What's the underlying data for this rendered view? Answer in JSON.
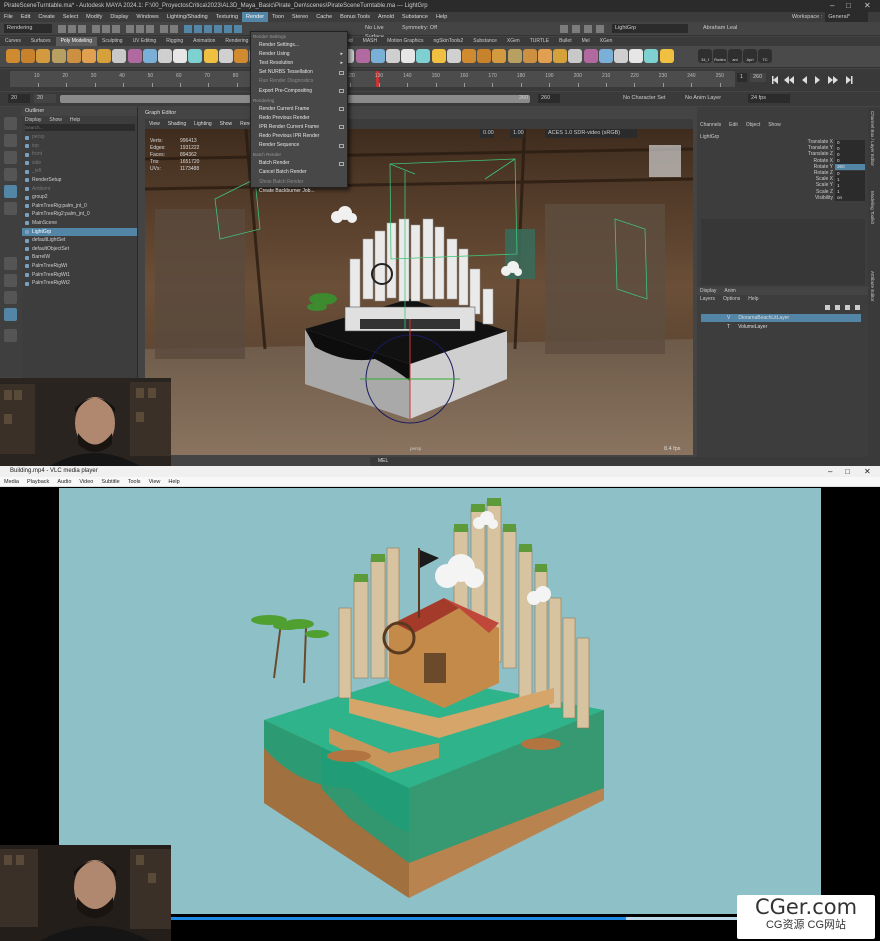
{
  "maya": {
    "title": "PirateSceneTurntable.ma* - Autodesk MAYA 2024.1: F:\\00_ProyectosCritica\\2023\\AL3D_Maya_Basic\\Pirate_Den\\scenes\\PirateSceneTurntable.ma  ---  LightGrp",
    "menus": [
      "File",
      "Edit",
      "Create",
      "Select",
      "Modify",
      "Display",
      "Windows",
      "Lighting/Shading",
      "Texturing",
      "Render",
      "Toon",
      "Stereo",
      "Cache",
      "Bonus Tools",
      "Arnold",
      "Substance",
      "Help"
    ],
    "workspace_label": "Workspace :",
    "workspace_value": "General*",
    "mode": "Rendering",
    "symmetry": "Symmetry: Off",
    "live_surface": "No Live Surface",
    "search_object": "LightGrp",
    "user": "Abraham Leal",
    "shelf_tabs": [
      "Curves",
      "Surfaces",
      "Poly Modeling",
      "Sculpting",
      "UV Editing",
      "Rigging",
      "Animation",
      "Rendering",
      "FX",
      "FX Caching",
      "Custom",
      "Arnold",
      "MASH",
      "Motion Graphics",
      "ngSkinTools2",
      "Substance",
      "XGen",
      "TURTLE",
      "Bullet",
      "Mel",
      "XGen"
    ],
    "shelf_labels": [
      "34_f",
      "Rodeo",
      "ani",
      "Apri",
      "TC"
    ],
    "timeline_ticks": [
      "10",
      "20",
      "30",
      "40",
      "50",
      "60",
      "70",
      "80",
      "90",
      "100",
      "110",
      "120",
      "130",
      "140",
      "150",
      "160",
      "170",
      "180",
      "190",
      "200",
      "210",
      "220",
      "230",
      "240",
      "250"
    ],
    "current_frame": "1",
    "end_frame": "260",
    "range_start": "20",
    "range_inner_start": "20",
    "range_end": "260",
    "range_end2": "260",
    "character_set": "No Character Set",
    "anim_layer": "No Anim Layer",
    "fps_setting": "24 fps",
    "outliner": {
      "title": "Outliner",
      "menu": [
        "Display",
        "Show",
        "Help"
      ],
      "search_placeholder": "Search...",
      "items": [
        {
          "label": "persp",
          "dim": true
        },
        {
          "label": "top",
          "dim": true
        },
        {
          "label": "front",
          "dim": true
        },
        {
          "label": "side",
          "dim": true
        },
        {
          "label": "_left",
          "dim": true
        },
        {
          "label": "RenderSetup",
          "dim": false
        },
        {
          "label": "Ambient",
          "dim": true
        },
        {
          "label": "group2",
          "dim": false
        },
        {
          "label": "PalmTreeRig:palm_jnt_0",
          "dim": false
        },
        {
          "label": "PalmTreeRig2:palm_jnt_0",
          "dim": false
        },
        {
          "label": "MainScene",
          "dim": false
        },
        {
          "label": "LightGrp",
          "dim": false,
          "selected": true
        },
        {
          "label": "defaultLightSet",
          "dim": false
        },
        {
          "label": "defaultObjectSet",
          "dim": false
        },
        {
          "label": "BarrelW",
          "dim": false
        },
        {
          "label": "PalmTreeRigWt",
          "dim": false
        },
        {
          "label": "PalmTreeRigWt1",
          "dim": false
        },
        {
          "label": "PalmTreeRigWt2",
          "dim": false
        }
      ]
    },
    "graph_editor": "Graph Editor",
    "viewport_menu": [
      "View",
      "Shading",
      "Lighting",
      "Show",
      "Renderer",
      "Panels"
    ],
    "hud": [
      {
        "label": "Verts:",
        "value": "996413"
      },
      {
        "label": "Edges:",
        "value": "1931222"
      },
      {
        "label": "Faces:",
        "value": "894362"
      },
      {
        "label": "Tris:",
        "value": "1651720"
      },
      {
        "label": "UVs:",
        "value": "1173488"
      }
    ],
    "color_space": "ACES 1.0 SDR-video (sRGB)",
    "exposure": "0.00",
    "gamma": "1.00",
    "viewport_fps": "8.4 fps",
    "camera": "persp",
    "render_menu": {
      "items": [
        {
          "label": "Render Settings",
          "type": "section"
        },
        {
          "label": "Render Settings...",
          "type": "item"
        },
        {
          "label": "Render Using",
          "type": "sub"
        },
        {
          "label": "Test Resolution",
          "type": "sub"
        },
        {
          "label": "Set NURBS Tessellation",
          "type": "box"
        },
        {
          "label": "Run Render Diagnostics",
          "type": "dim"
        },
        {
          "label": "Export Pre-Compositing",
          "type": "box"
        },
        {
          "label": "Rendering",
          "type": "section"
        },
        {
          "label": "Render Current Frame",
          "type": "box"
        },
        {
          "label": "Redo Previous Render",
          "type": "item"
        },
        {
          "label": "IPR Render Current Frame",
          "type": "box"
        },
        {
          "label": "Redo Previous IPR Render",
          "type": "item"
        },
        {
          "label": "Render Sequence",
          "type": "box"
        },
        {
          "label": "Batch Render",
          "type": "section"
        },
        {
          "label": "Batch Render",
          "type": "box"
        },
        {
          "label": "Cancel Batch Render",
          "type": "item"
        },
        {
          "label": "Show Batch Render",
          "type": "dim"
        },
        {
          "label": "Create Backburner Job...",
          "type": "item"
        }
      ]
    },
    "channel_box": {
      "menu": [
        "Channels",
        "Edit",
        "Object",
        "Show"
      ],
      "object": "LightGrp",
      "channels": [
        {
          "label": "Translate X",
          "value": "0"
        },
        {
          "label": "Translate Y",
          "value": "0"
        },
        {
          "label": "Translate Z",
          "value": "0"
        },
        {
          "label": "Rotate X",
          "value": "0"
        },
        {
          "label": "Rotate Y",
          "value": "360",
          "hl": true
        },
        {
          "label": "Rotate Z",
          "value": "0"
        },
        {
          "label": "Scale X",
          "value": "1"
        },
        {
          "label": "Scale Y",
          "value": "1"
        },
        {
          "label": "Scale Z",
          "value": "1"
        },
        {
          "label": "Visibility",
          "value": "on"
        }
      ]
    },
    "layer_editor": {
      "tabs": [
        "Display",
        "Anim"
      ],
      "menu": [
        "Layers",
        "Options",
        "Help"
      ],
      "layers": [
        {
          "flag": "V",
          "label": "DioramaBeachLitLayer",
          "selected": true
        },
        {
          "flag": "T",
          "label": "VolumeLayer",
          "selected": false
        }
      ]
    },
    "side_tabs": [
      "Channel Box / Layer Editor",
      "Modeling Toolkit",
      "Attribute Editor"
    ],
    "mel_label": "MEL"
  },
  "vlc": {
    "title": "Building.mp4 - VLC media player",
    "menus": [
      "Media",
      "Playback",
      "Audio",
      "Video",
      "Subtitle",
      "Tools",
      "View",
      "Help"
    ],
    "progress": 0.71
  },
  "watermark": {
    "big": "CGer.com",
    "small": "CG资源  CG网站"
  },
  "colors": {
    "maya_bg": "#444444",
    "highlight": "#5285a6",
    "video_bg": "#8ec0c8",
    "water": "#1f9e78",
    "sand": "#b8834e"
  }
}
